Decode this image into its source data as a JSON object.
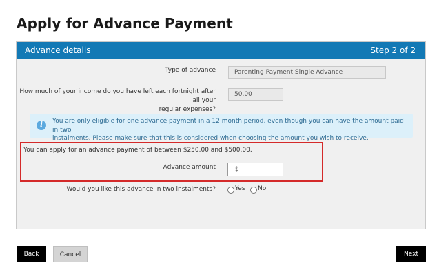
{
  "page": {
    "title": "Apply for Advance Payment"
  },
  "panel": {
    "title": "Advance details",
    "step": "Step 2 of 2",
    "type_of_advance": {
      "label": "Type of advance",
      "value": "Parenting Payment Single Advance"
    },
    "income_left": {
      "label_line1": "How much of your income do you have left each fortnight after all your",
      "label_line2": "regular expenses?",
      "value": "50.00"
    },
    "info": {
      "icon": "info-icon",
      "line1": "You are only eligible for one advance payment in a 12 month period, even though you can have the amount paid in two",
      "line2": "instalments. Please make sure that this is considered when choosing the amount you wish to receive."
    },
    "range_text": "You can apply for an advance payment of between $250.00 and $500.00.",
    "advance_amount": {
      "label": "Advance amount",
      "placeholder": "$"
    },
    "instalments": {
      "question": "Would you like this advance in two instalments?",
      "options": [
        "Yes",
        "No"
      ]
    }
  },
  "buttons": {
    "back": "Back",
    "cancel": "Cancel",
    "next": "Next"
  },
  "colors": {
    "header": "#1379b5",
    "info_bg": "#dcf0fa",
    "highlight": "#d42a2a"
  }
}
